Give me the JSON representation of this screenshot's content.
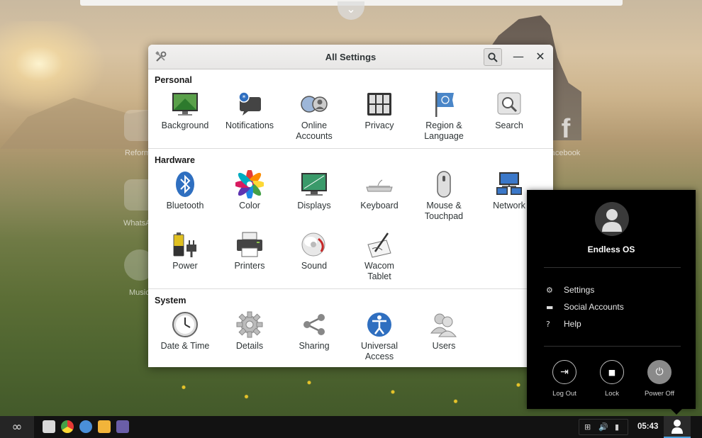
{
  "window": {
    "title": "All Settings",
    "sections": [
      {
        "name": "Personal",
        "items": [
          {
            "label": "Background"
          },
          {
            "label": "Notifications"
          },
          {
            "label": "Online\nAccounts"
          },
          {
            "label": "Privacy"
          },
          {
            "label": "Region &\nLanguage"
          },
          {
            "label": "Search"
          }
        ]
      },
      {
        "name": "Hardware",
        "items": [
          {
            "label": "Bluetooth"
          },
          {
            "label": "Color"
          },
          {
            "label": "Displays"
          },
          {
            "label": "Keyboard"
          },
          {
            "label": "Mouse &\nTouchpad"
          },
          {
            "label": "Network"
          },
          {
            "label": "Power"
          },
          {
            "label": "Printers"
          },
          {
            "label": "Sound"
          },
          {
            "label": "Wacom\nTablet"
          }
        ]
      },
      {
        "name": "System",
        "items": [
          {
            "label": "Date & Time"
          },
          {
            "label": "Details"
          },
          {
            "label": "Sharing"
          },
          {
            "label": "Universal\nAccess"
          },
          {
            "label": "Users"
          }
        ]
      }
    ]
  },
  "desktop": {
    "labels": [
      "Reform",
      "WhatsA",
      "Music",
      "Facebook"
    ]
  },
  "user_menu": {
    "name": "Endless OS",
    "items": [
      {
        "label": "Settings",
        "icon": "gear-icon"
      },
      {
        "label": "Social Accounts",
        "icon": "chat-icon"
      },
      {
        "label": "Help",
        "icon": "help-icon"
      }
    ],
    "actions": [
      {
        "label": "Log Out",
        "icon": "logout-icon"
      },
      {
        "label": "Lock",
        "icon": "lock-icon"
      },
      {
        "label": "Power Off",
        "icon": "power-icon"
      }
    ]
  },
  "taskbar": {
    "clock": "05:43",
    "apps": [
      "files-app-icon",
      "chrome-app-icon",
      "browser-app-icon",
      "folder-app-icon",
      "settings-app-icon"
    ]
  },
  "colors": {
    "menu_bg": "#000000",
    "accent": "#4aa3df"
  }
}
